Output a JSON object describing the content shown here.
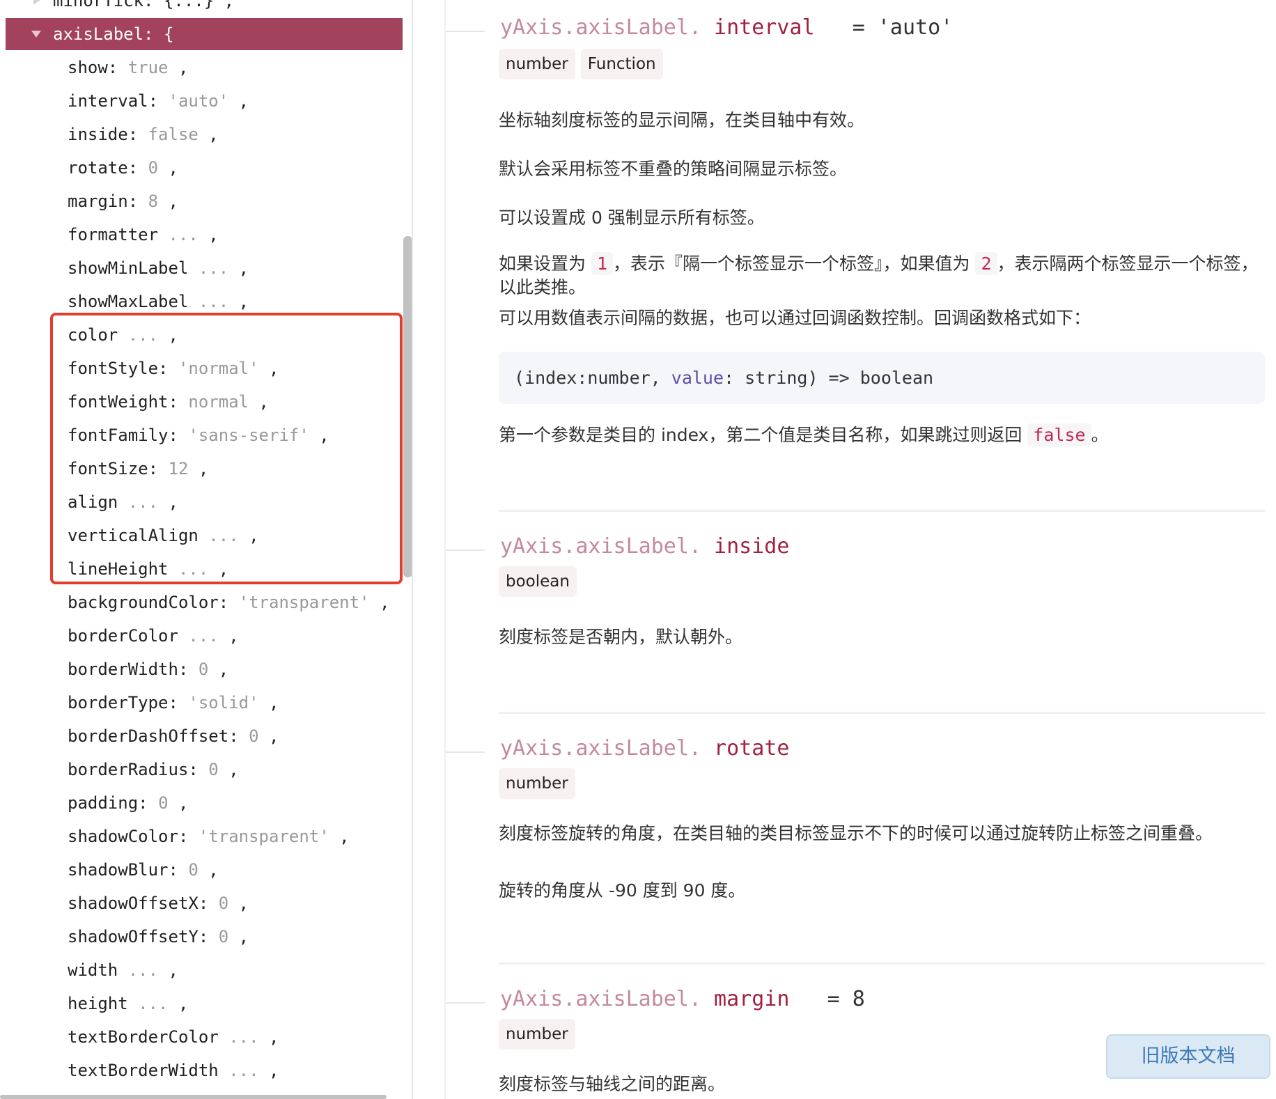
{
  "tree": {
    "partial_top": {
      "key": "minorTick",
      "value": "{...}"
    },
    "selected": {
      "key": "axisLabel",
      "value": "{"
    },
    "items": [
      {
        "key": "show",
        "colon": true,
        "value": "true"
      },
      {
        "key": "interval",
        "colon": true,
        "value": "'auto'"
      },
      {
        "key": "inside",
        "colon": true,
        "value": "false"
      },
      {
        "key": "rotate",
        "colon": true,
        "value": "0"
      },
      {
        "key": "margin",
        "colon": true,
        "value": "8"
      },
      {
        "key": "formatter",
        "colon": false,
        "value": "..."
      },
      {
        "key": "showMinLabel",
        "colon": false,
        "value": "..."
      },
      {
        "key": "showMaxLabel",
        "colon": false,
        "value": "..."
      },
      {
        "key": "color",
        "colon": false,
        "value": "..."
      },
      {
        "key": "fontStyle",
        "colon": true,
        "value": "'normal'"
      },
      {
        "key": "fontWeight",
        "colon": true,
        "value": "normal"
      },
      {
        "key": "fontFamily",
        "colon": true,
        "value": "'sans-serif'"
      },
      {
        "key": "fontSize",
        "colon": true,
        "value": "12"
      },
      {
        "key": "align",
        "colon": false,
        "value": "..."
      },
      {
        "key": "verticalAlign",
        "colon": false,
        "value": "..."
      },
      {
        "key": "lineHeight",
        "colon": false,
        "value": "..."
      },
      {
        "key": "backgroundColor",
        "colon": true,
        "value": "'transparent'"
      },
      {
        "key": "borderColor",
        "colon": false,
        "value": "..."
      },
      {
        "key": "borderWidth",
        "colon": true,
        "value": "0"
      },
      {
        "key": "borderType",
        "colon": true,
        "value": "'solid'"
      },
      {
        "key": "borderDashOffset",
        "colon": true,
        "value": "0"
      },
      {
        "key": "borderRadius",
        "colon": true,
        "value": "0"
      },
      {
        "key": "padding",
        "colon": true,
        "value": "0"
      },
      {
        "key": "shadowColor",
        "colon": true,
        "value": "'transparent'"
      },
      {
        "key": "shadowBlur",
        "colon": true,
        "value": "0"
      },
      {
        "key": "shadowOffsetX",
        "colon": true,
        "value": "0"
      },
      {
        "key": "shadowOffsetY",
        "colon": true,
        "value": "0"
      },
      {
        "key": "width",
        "colon": false,
        "value": "..."
      },
      {
        "key": "height",
        "colon": false,
        "value": "..."
      },
      {
        "key": "textBorderColor",
        "colon": false,
        "value": "..."
      },
      {
        "key": "textBorderWidth",
        "colon": false,
        "value": "..."
      }
    ],
    "selected_color": "#a3425c",
    "highlight_box_color": "#e43c2e"
  },
  "doc": {
    "prefix": "yAxis.axisLabel.",
    "interval": {
      "name": "interval",
      "default": "= 'auto'",
      "types": [
        "number",
        "Function"
      ],
      "p1": "坐标轴刻度标签的显示间隔，在类目轴中有效。",
      "p2": "默认会采用标签不重叠的策略间隔显示标签。",
      "p3": "可以设置成 0 强制显示所有标签。",
      "p4a": "如果设置为 ",
      "p4c1": "1",
      "p4b": "，表示『隔一个标签显示一个标签』，如果值为 ",
      "p4c2": "2",
      "p4d": "，表示隔两个标签显示一个标签，以此类推。",
      "p5": "可以用数值表示间隔的数据，也可以通过回调函数控制。回调函数格式如下：",
      "code_a": "(index:number, ",
      "code_hl": "value",
      "code_b": ": string) => boolean",
      "p6a": "第一个参数是类目的 index，第二个值是类目名称，如果跳过则返回 ",
      "p6c": "false",
      "p6b": "。"
    },
    "inside": {
      "name": "inside",
      "types": [
        "boolean"
      ],
      "p1": "刻度标签是否朝内，默认朝外。"
    },
    "rotate": {
      "name": "rotate",
      "types": [
        "number"
      ],
      "p1": "刻度标签旋转的角度，在类目轴的类目标签显示不下的时候可以通过旋转防止标签之间重叠。",
      "p2": "旋转的角度从 -90 度到 90 度。"
    },
    "margin": {
      "name": "margin",
      "default": "= 8",
      "types": [
        "number"
      ],
      "p1": "刻度标签与轴线之间的距离。"
    }
  },
  "old_version_button": "旧版本文档"
}
